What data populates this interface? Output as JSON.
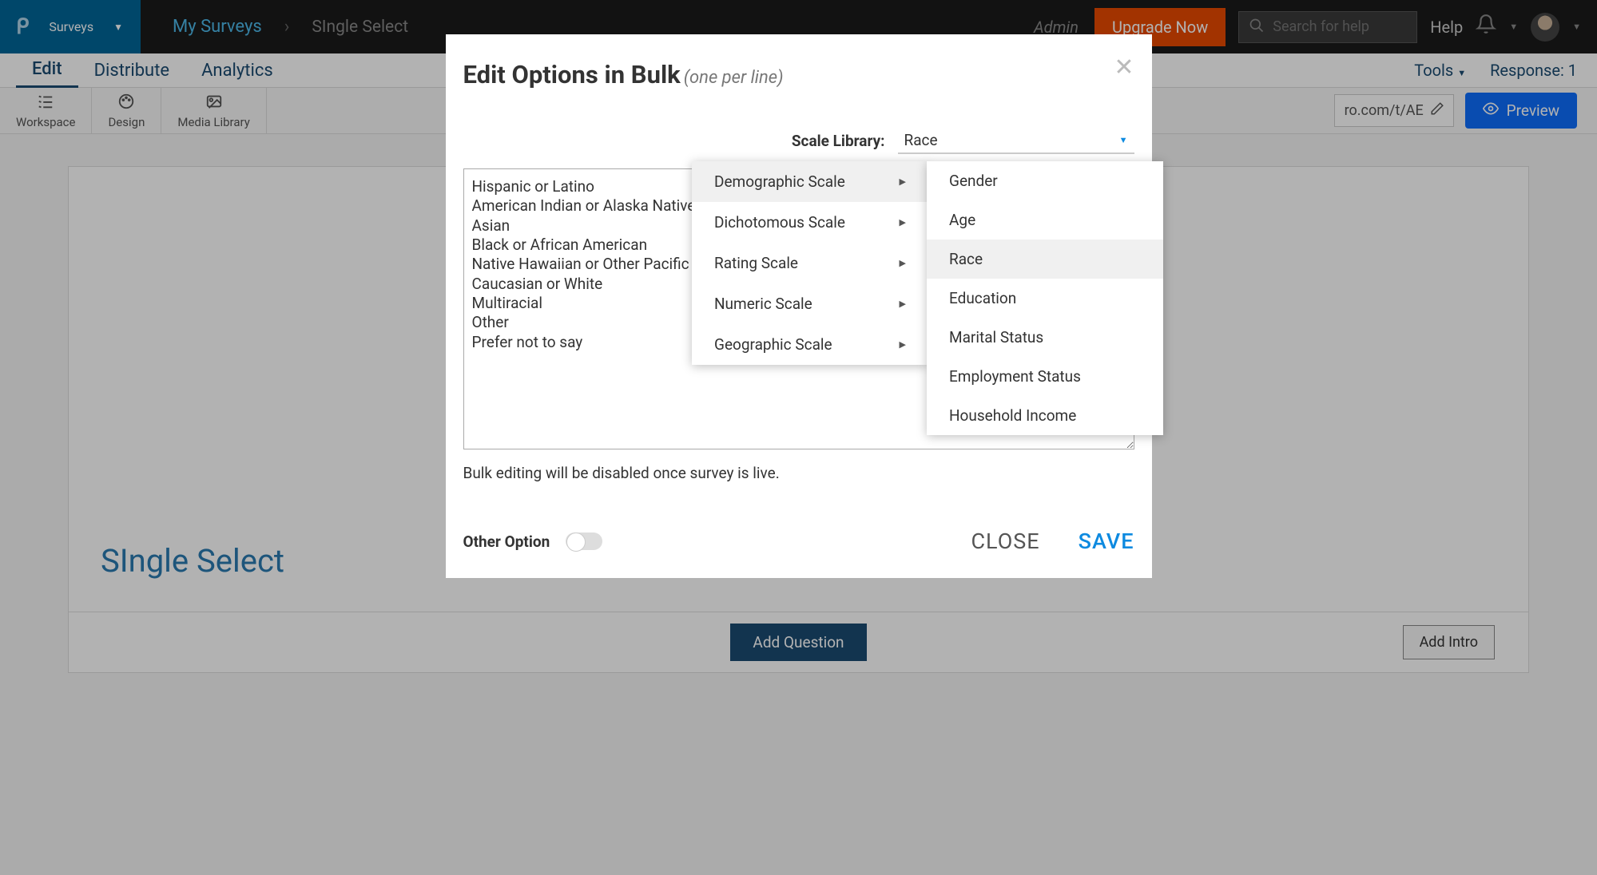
{
  "header": {
    "surveys_label": "Surveys",
    "breadcrumb_link": "My Surveys",
    "breadcrumb_current": "SIngle Select",
    "admin": "Admin",
    "upgrade": "Upgrade Now",
    "search_placeholder": "Search for help",
    "help": "Help"
  },
  "tabs": {
    "edit": "Edit",
    "distribute": "Distribute",
    "analytics": "Analytics",
    "tools": "Tools",
    "response": "Response: 1"
  },
  "toolbar": {
    "workspace": "Workspace",
    "design": "Design",
    "media": "Media Library",
    "url_fragment": "ro.com/t/AE",
    "preview": "Preview"
  },
  "survey": {
    "title": "SIngle Select",
    "add_question": "Add Question",
    "add_intro": "Add Intro"
  },
  "modal": {
    "title": "Edit Options in Bulk",
    "subtitle": "(one per line)",
    "scale_library_label": "Scale Library:",
    "scale_value": "Race",
    "options_text": "Hispanic or Latino\nAmerican Indian or Alaska Native\nAsian\nBlack or African American\nNative Hawaiian or Other Pacific Islander\nCaucasian or White\nMultiracial\nOther\nPrefer not to say",
    "note": "Bulk editing will be disabled once survey is live.",
    "other_option": "Other Option",
    "close": "CLOSE",
    "save": "SAVE"
  },
  "scale_menu": {
    "items": [
      "Demographic Scale",
      "Dichotomous Scale",
      "Rating Scale",
      "Numeric Scale",
      "Geographic Scale"
    ]
  },
  "demographic_submenu": {
    "items": [
      "Gender",
      "Age",
      "Race",
      "Education",
      "Marital Status",
      "Employment Status",
      "Household Income"
    ]
  }
}
